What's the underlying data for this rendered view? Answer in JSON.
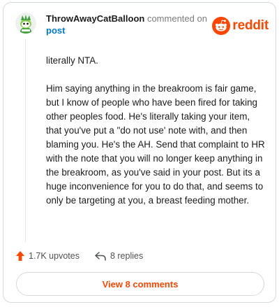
{
  "comment": {
    "username": "ThrowAwayCatBalloon",
    "commented_text": " commented on",
    "post_link_label": "post",
    "body": "literally NTA.\n\nHim saying anything in the breakroom is fair game, but I know of people who have been fired for taking other peoples food. He's literally taking your item, that you've put a \"do not use' note with, and then blaming you. He's the AH. Send that complaint to HR with the note that you will no longer keep anything in the breakroom, as you've said in your post. But its a huge inconvenience for you to do that, and seems to only be targeting at you, a breast feeding mother."
  },
  "brand": {
    "wordmark": "reddit",
    "color": "#ff4500",
    "icon": "reddit-snoo-icon"
  },
  "actions": {
    "upvotes_label": "1.7K upvotes",
    "upvote_icon": "upvote-arrow-icon",
    "upvote_color": "#ff4500",
    "replies_label": "8 replies",
    "reply_icon": "reply-arrow-icon"
  },
  "view_comments_label": "View 8 comments"
}
